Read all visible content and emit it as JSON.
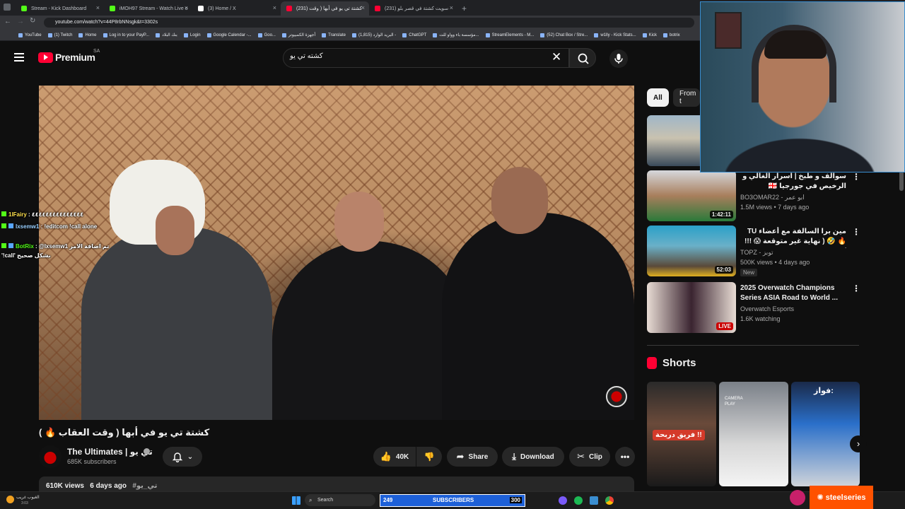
{
  "browser": {
    "tabs": [
      {
        "title": "Stream - Kick Dashboard",
        "color": "#53fc18"
      },
      {
        "title": "iMOH97 Stream - Watch Live o",
        "color": "#53fc18"
      },
      {
        "title": "(3) Home / X",
        "color": "#ffffff"
      },
      {
        "title": "(231) كشتة تي يو في أبها ( وقت",
        "color": "#ff0033"
      },
      {
        "title": "(231) سويت كشتة في قصر بلو",
        "color": "#ff0033"
      }
    ],
    "new_tab": "+",
    "url": "youtube.com/watch?v=44P8rbNNsgk&t=3302s",
    "bookmarks": [
      "YouTube",
      "(1) Twitch",
      "Home",
      "Log in to your PayP...",
      "بنك البلاد",
      "Login",
      "Google Calendar -...",
      "Goo...",
      "أجهزة الكمبيوتر",
      "Translate",
      "(1,815) البريد الوارد -",
      "ChatGPT",
      "مؤسسة باء وواو للت...",
      "StreamElements - M...",
      "(52) Chat Box / Stre...",
      "w1lly - Kick Stats...",
      "Kick",
      "botrix"
    ]
  },
  "youtube": {
    "logo": "Premium",
    "logo_region": "SA",
    "search_query": "كشته تي يو",
    "video": {
      "title": "كشتة تي يو في أبها ( وقت العقاب 🔥 )",
      "channel": "The Ultimates | تي يو",
      "subscribers": "685K subscribers",
      "likes": "40K",
      "share": "Share",
      "download": "Download",
      "clip": "Clip",
      "views": "610K views",
      "age": "6 days ago",
      "tag": "#تي_يو"
    },
    "chips": [
      "All",
      "From t"
    ],
    "recommendations": [
      {
        "title": "سوالف و طبخ | اسرار الغالي و الرخيص في جورجيا 🇬🇪",
        "channel": "BO3OMAR22 - ابو عمر",
        "meta": "1.5M views • 7 days ago",
        "duration": "1:42:11",
        "badge": "",
        "rtl": true
      },
      {
        "title": "مين برا السالفة مع أعضاء TU 🔥 🤣 ( نهاية غير متوقعة 😱 !!! )",
        "channel": "TOPZ - توبز",
        "meta": "500K views • 4 days ago",
        "duration": "52:03",
        "badge": "New",
        "rtl": true
      },
      {
        "title": "2025 Overwatch Champions Series ASIA Road to World ...",
        "channel": "Overwatch Esports",
        "meta": "1.6K watching",
        "duration": "LIVE",
        "badge": "",
        "rtl": false
      }
    ],
    "shorts_heading": "Shorts",
    "shorts": [
      {
        "caption": "فريق دربحة !!",
        "color": "#d43a2a"
      },
      {
        "caption": "CAMERA PLAY",
        "color": "#cfcfcf"
      },
      {
        "caption": "فواز:",
        "color": "#2a6fc9"
      }
    ]
  },
  "chat": [
    {
      "user": "1lFairy",
      "text": ": ٤٤٤٤٤٤٤٤٤٤٤٤٤٤٤"
    },
    {
      "user": "lxsemw1",
      "text": ": !editcom !call alone"
    },
    {
      "user": "BotRix",
      "text": ": @lxsemw1 تم اضافة الامر"
    },
    {
      "user": "",
      "text": "'!call' بشكل صحيح"
    }
  ],
  "taskbar": {
    "weather": "الغيوب غريب",
    "weather_sub": "3:03",
    "search": "Search",
    "subs_count": "249",
    "subs_label": "SUBSCRIBERS",
    "subs_goal": "300",
    "steelseries": "steelseries"
  }
}
